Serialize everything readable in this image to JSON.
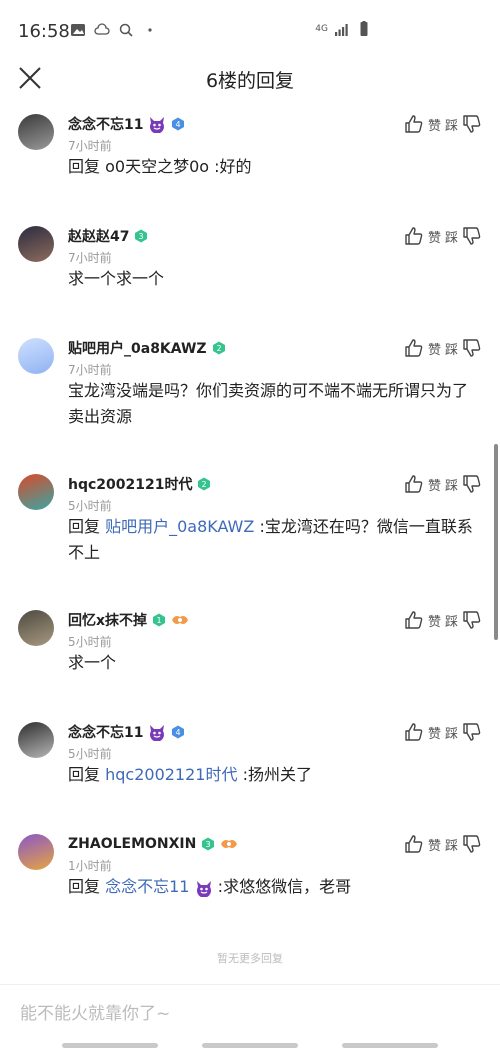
{
  "status_bar": {
    "time": "16:58",
    "network": "4G"
  },
  "header": {
    "title": "6楼的回复"
  },
  "actions": {
    "like_label": "赞",
    "dislike_label": "踩"
  },
  "reply_prefix": "回复",
  "colors": {
    "link": "#3e6ab8",
    "badge_blue": "#4a90e2",
    "badge_green": "#35c48f",
    "badge_devil": "#7a3bb8"
  },
  "comments": [
    {
      "username": "念念不忘11",
      "devil": true,
      "level": "4",
      "level_color": "blue",
      "time": "7小时前",
      "is_reply": true,
      "reply_to": "o0天空之梦0o",
      "reply_to_devil": false,
      "reply_to_linked": false,
      "text": ":好的"
    },
    {
      "username": "赵赵赵47",
      "devil": false,
      "level": "3",
      "level_color": "green",
      "time": "7小时前",
      "is_reply": false,
      "text": "求一个求一个"
    },
    {
      "username": "贴吧用户_0a8KAWZ",
      "devil": false,
      "level": "2",
      "level_color": "green",
      "time": "7小时前",
      "is_reply": false,
      "text": "宝龙湾没端是吗？你们卖资源的可不端不端无所谓只为了卖出资源"
    },
    {
      "username": "hqc2002121时代",
      "devil": false,
      "level": "2",
      "level_color": "green",
      "time": "5小时前",
      "is_reply": true,
      "reply_to": "贴吧用户_0a8KAWZ",
      "reply_to_devil": false,
      "reply_to_linked": true,
      "text": ":宝龙湾还在吗？微信一直联系不上"
    },
    {
      "username": "回忆x抹不掉",
      "devil": false,
      "level": "1",
      "level_color": "green",
      "fire": true,
      "time": "5小时前",
      "is_reply": false,
      "text": "求一个"
    },
    {
      "username": "念念不忘11",
      "devil": true,
      "level": "4",
      "level_color": "blue",
      "time": "5小时前",
      "is_reply": true,
      "reply_to": "hqc2002121时代",
      "reply_to_devil": false,
      "reply_to_linked": true,
      "text": ":扬州关了"
    },
    {
      "username": "ZHAOLEMONXIN",
      "devil": false,
      "level": "3",
      "level_color": "green",
      "fire": true,
      "time": "1小时前",
      "is_reply": true,
      "reply_to": "念念不忘11",
      "reply_to_devil": true,
      "reply_to_linked": true,
      "text": ":求悠悠微信，老哥"
    }
  ],
  "footer": {
    "no_more": "暂无更多回复",
    "input_placeholder": "能不能火就靠你了~"
  }
}
